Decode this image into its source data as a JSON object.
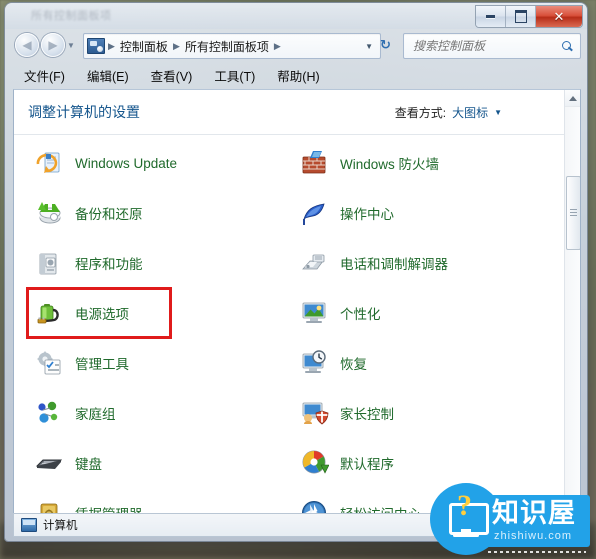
{
  "window": {
    "title_faint": "所有控制面板项",
    "buttons": {
      "minimize": "minimize",
      "maximize": "maximize",
      "close": "✕"
    }
  },
  "addressbar": {
    "icon": "control-panel-icon",
    "crumbs": [
      "控制面板",
      "所有控制面板项"
    ],
    "separator": "▶",
    "dropdown_caret": "▼",
    "refresh": "↻"
  },
  "search": {
    "placeholder": "搜索控制面板",
    "value": "",
    "icon": "search-icon"
  },
  "menubar": {
    "items": [
      "文件(F)",
      "编辑(E)",
      "查看(V)",
      "工具(T)",
      "帮助(H)"
    ]
  },
  "content": {
    "heading": "调整计算机的设置",
    "viewby_label": "查看方式:",
    "viewby_value": "大图标",
    "viewby_caret": "▼"
  },
  "items": {
    "left": [
      {
        "label": "Windows Update",
        "icon": "windows-update-icon",
        "highlighted": false
      },
      {
        "label": "备份和还原",
        "icon": "backup-restore-icon",
        "highlighted": false
      },
      {
        "label": "程序和功能",
        "icon": "programs-features-icon",
        "highlighted": false
      },
      {
        "label": "电源选项",
        "icon": "power-options-icon",
        "highlighted": true
      },
      {
        "label": "管理工具",
        "icon": "administrative-tools-icon",
        "highlighted": false
      },
      {
        "label": "家庭组",
        "icon": "homegroup-icon",
        "highlighted": false
      },
      {
        "label": "键盘",
        "icon": "keyboard-icon",
        "highlighted": false
      },
      {
        "label": "凭据管理器",
        "icon": "credential-manager-icon",
        "highlighted": false
      }
    ],
    "right": [
      {
        "label": "Windows 防火墙",
        "icon": "windows-firewall-icon",
        "highlighted": false
      },
      {
        "label": "操作中心",
        "icon": "action-center-icon",
        "highlighted": false
      },
      {
        "label": "电话和调制解调器",
        "icon": "phone-modem-icon",
        "highlighted": false
      },
      {
        "label": "个性化",
        "icon": "personalization-icon",
        "highlighted": false
      },
      {
        "label": "恢复",
        "icon": "recovery-icon",
        "highlighted": false
      },
      {
        "label": "家长控制",
        "icon": "parental-controls-icon",
        "highlighted": false
      },
      {
        "label": "默认程序",
        "icon": "default-programs-icon",
        "highlighted": false
      },
      {
        "label": "轻松访问中心",
        "icon": "ease-of-access-icon",
        "highlighted": false
      }
    ]
  },
  "statusbar": {
    "icon": "computer-icon",
    "text": "计算机"
  },
  "scrollbar": {
    "up_arrow": "▲",
    "down_arrow": "▼"
  },
  "watermark": {
    "name": "知识屋",
    "url": "zhishiwu.com",
    "question_mark": "?"
  },
  "colors": {
    "item_label": "#206a2c",
    "heading": "#14558c",
    "highlight_box": "#e01b1b",
    "watermark_blue": "#22a2e8",
    "close_button_red": "#b72d18"
  }
}
